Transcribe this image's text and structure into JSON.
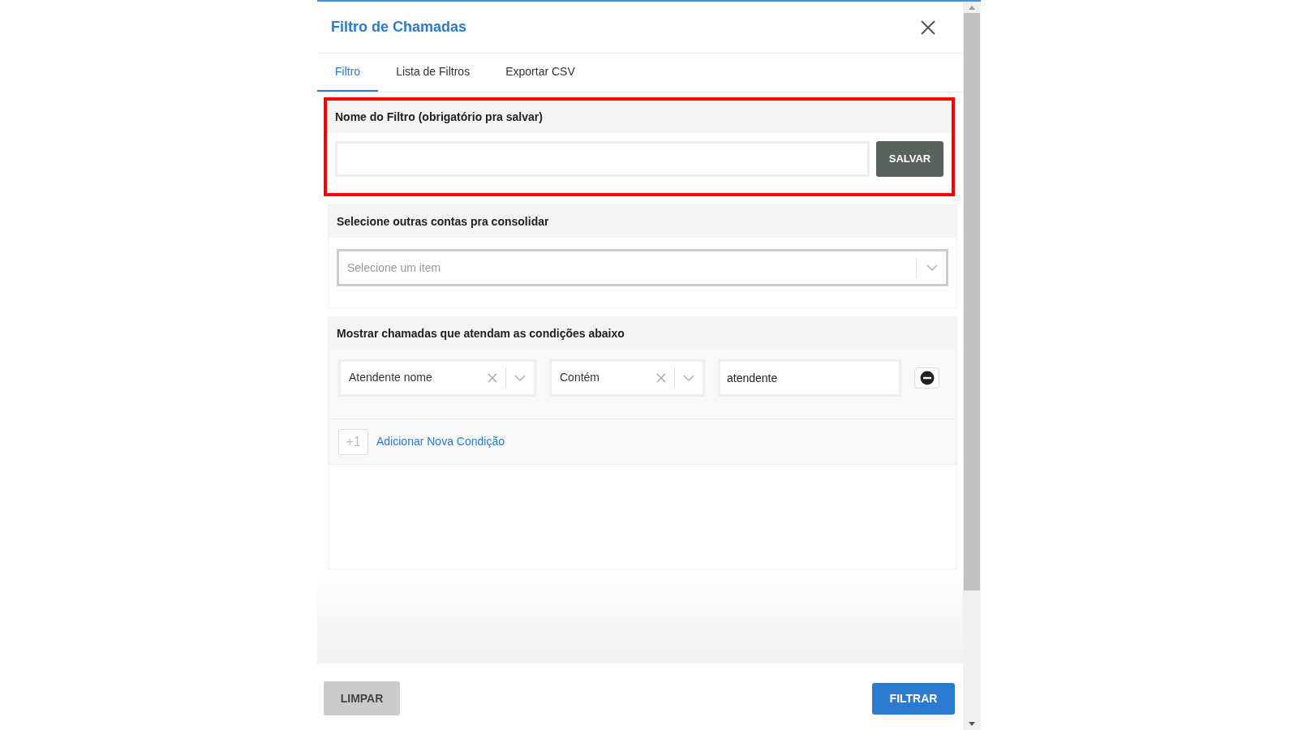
{
  "dialog": {
    "title": "Filtro de Chamadas"
  },
  "tabs": [
    {
      "label": "Filtro",
      "selected": true
    },
    {
      "label": "Lista de Filtros",
      "selected": false
    },
    {
      "label": "Exportar CSV",
      "selected": false
    }
  ],
  "name_section": {
    "heading": "Nome do Filtro (obrigatório pra salvar)",
    "highlighted": true,
    "save_button": "SALVAR"
  },
  "accounts_section": {
    "heading": "Selecione outras contas pra consolidar",
    "highlighted": false,
    "placeholder": "Selecione um item"
  },
  "conditions_section": {
    "heading": "Mostrar chamadas que atendam as condições abaixo",
    "highlighted": false,
    "conditions": [
      {
        "field": "Atendente nome",
        "operator": "Contém",
        "value": "atendente"
      }
    ],
    "add_icon": "+1",
    "add_link": "Adicionar Nova Condição"
  },
  "footer": {
    "clear_button": "LIMPAR",
    "filter_button": "FILTRAR"
  }
}
